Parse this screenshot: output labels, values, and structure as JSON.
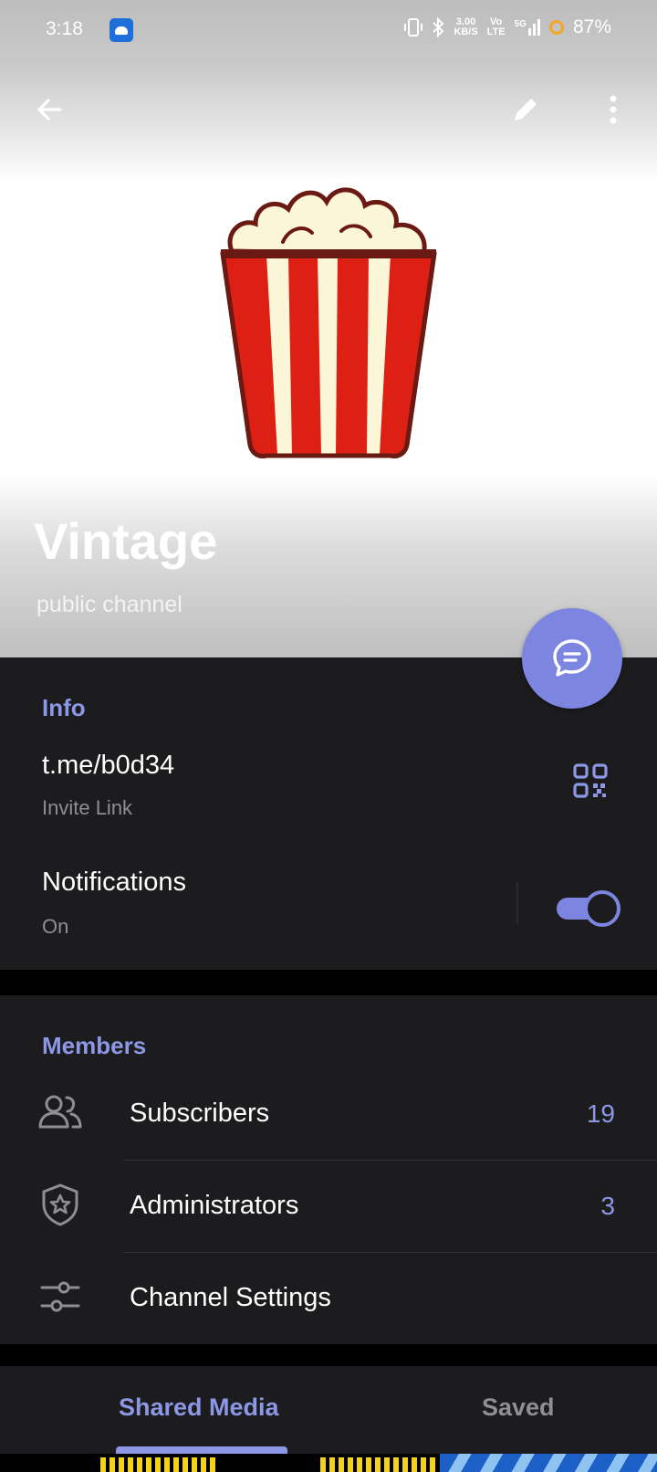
{
  "status_bar": {
    "time": "3:18",
    "net_speed_top": "3.00",
    "net_speed_bottom": "KB/S",
    "volte_top": "Vo",
    "volte_bottom": "LTE",
    "network": "5G",
    "battery": "87%"
  },
  "channel": {
    "name": "Vintage",
    "type": "public channel"
  },
  "info": {
    "header": "Info",
    "link": "t.me/b0d34",
    "link_label": "Invite Link",
    "notifications_label": "Notifications",
    "notifications_value": "On",
    "notifications_enabled": true
  },
  "members": {
    "header": "Members",
    "rows": [
      {
        "label": "Subscribers",
        "value": "19",
        "icon": "people-icon"
      },
      {
        "label": "Administrators",
        "value": "3",
        "icon": "shield-star-icon"
      },
      {
        "label": "Channel Settings",
        "value": "",
        "icon": "sliders-icon"
      }
    ]
  },
  "tabs": {
    "shared_media": "Shared Media",
    "saved": "Saved",
    "active": "shared_media"
  },
  "colors": {
    "accent": "#8c97e6",
    "fab": "#7c86e0",
    "panel": "#1c1c1e"
  }
}
